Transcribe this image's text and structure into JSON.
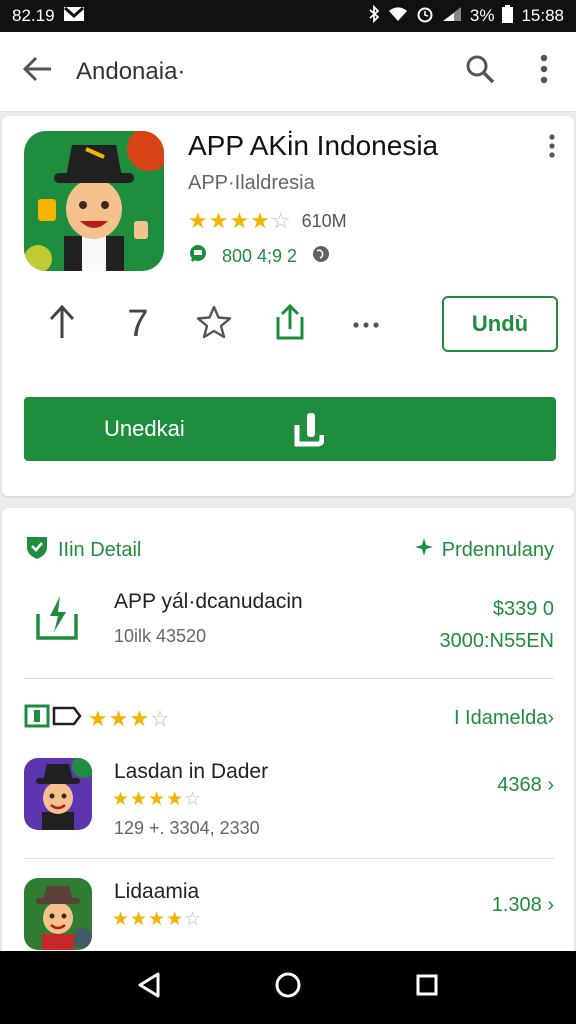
{
  "status": {
    "time_left": "82.19",
    "battery": "3%",
    "time_right": "15:88"
  },
  "appbar": {
    "title": "Andonaia·"
  },
  "app": {
    "name": "APP AKi̇n Indonesia",
    "developer": "APP·Ilaldresia",
    "rating_count": "610M",
    "info_text": "800 4;9 2",
    "rating_stars": 4
  },
  "actions": {
    "number": "7",
    "outlined_label": "Undù",
    "primary_label": "Unedkai"
  },
  "detail": {
    "header_left": "IIin Detail",
    "header_right": "Prdennulany",
    "title": "APP yál·dcanudacin",
    "sub": "10ilk 43520",
    "price1": "$339 0",
    "price2": "3000:N55EN"
  },
  "list": {
    "header_stars": 3,
    "header_right": "I Idamelda›",
    "items": [
      {
        "name": "Lasdan in Dader",
        "meta": "129 +. 3304, 2330",
        "price": "4368 ›",
        "stars": 4
      },
      {
        "name": "Lidaamia",
        "meta": "",
        "price": "1.308 ›",
        "stars": 4
      }
    ]
  },
  "colors": {
    "accent": "#1e8e3e",
    "star": "#f4b400",
    "star_off": "#bdbdbd"
  }
}
